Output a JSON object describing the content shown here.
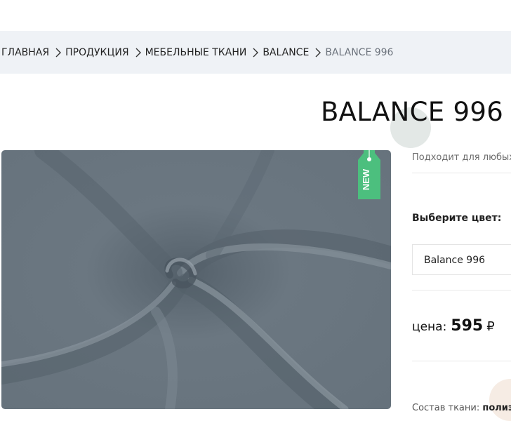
{
  "breadcrumb": {
    "items": [
      {
        "label": "ГЛАВНАЯ"
      },
      {
        "label": "ПРОДУКЦИЯ"
      },
      {
        "label": "МЕБЕЛЬНЫЕ ТКАНИ"
      },
      {
        "label": "BALANCE"
      }
    ],
    "current": "BALANCE 996"
  },
  "product": {
    "title": "BALANCE 996",
    "badge": "NEW",
    "subtitle": "Подходит для любых",
    "color_label": "Выберите цвет:",
    "color_selected": "Balance 996",
    "price_label": "цена:",
    "price_value": "595",
    "currency": "₽",
    "composition_label": "Состав ткани:",
    "composition_value": "полиэ"
  },
  "colors": {
    "breadcrumb_bg": "#eff2f6",
    "fabric": "#6a7680",
    "badge": "#4cbf7e"
  },
  "icons": {
    "separator": "chevron-right-icon"
  }
}
